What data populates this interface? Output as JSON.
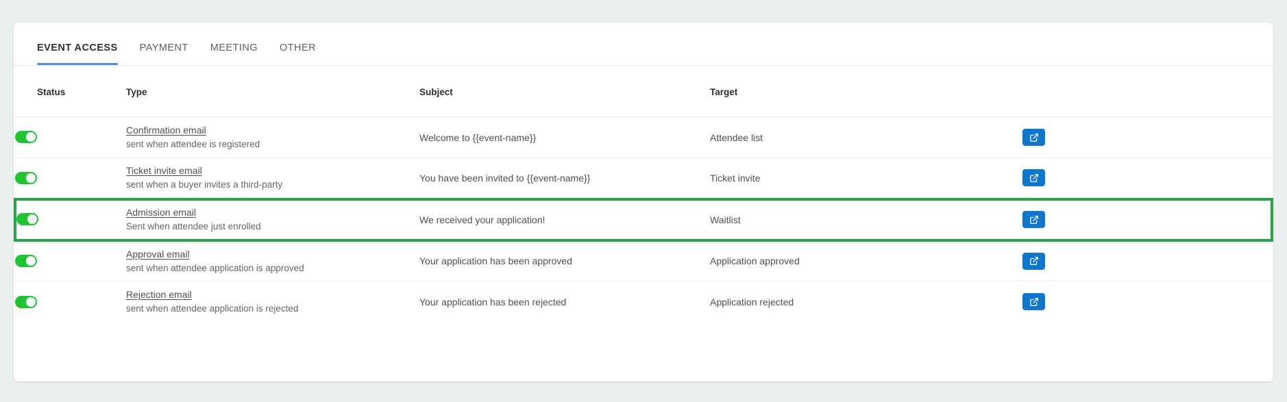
{
  "tabs": [
    {
      "label": "EVENT ACCESS",
      "active": true
    },
    {
      "label": "PAYMENT",
      "active": false
    },
    {
      "label": "MEETING",
      "active": false
    },
    {
      "label": "OTHER",
      "active": false
    }
  ],
  "table": {
    "headers": {
      "status": "Status",
      "type": "Type",
      "subject": "Subject",
      "target": "Target"
    },
    "rows": [
      {
        "enabled": true,
        "type_name": "Confirmation email",
        "type_desc": "sent when attendee is registered",
        "subject": "Welcome to {{event-name}}",
        "target": "Attendee list",
        "action_icon": "external-link-icon",
        "highlighted": false
      },
      {
        "enabled": true,
        "type_name": "Ticket invite email",
        "type_desc": "sent when a buyer invites a third-party",
        "subject": "You have been invited to {{event-name}}",
        "target": "Ticket invite",
        "action_icon": "external-link-icon",
        "highlighted": false
      },
      {
        "enabled": true,
        "type_name": "Admission email",
        "type_desc": "Sent when attendee just enrolled",
        "subject": "We received your application!",
        "target": "Waitlist",
        "action_icon": "external-link-icon",
        "highlighted": true
      },
      {
        "enabled": true,
        "type_name": "Approval email",
        "type_desc": "sent when attendee application is approved",
        "subject": "Your application has been approved",
        "target": "Application approved",
        "action_icon": "external-link-icon",
        "highlighted": false
      },
      {
        "enabled": true,
        "type_name": "Rejection email",
        "type_desc": "sent when attendee application is rejected",
        "subject": "Your application has been rejected",
        "target": "Application rejected",
        "action_icon": "external-link-icon",
        "highlighted": false
      }
    ]
  },
  "colors": {
    "accent_blue": "#4a90d9",
    "button_blue": "#1076cd",
    "toggle_green": "#1fc431",
    "highlight_green": "#21a845",
    "page_background": "#eceff0",
    "card_background": "#ffffff"
  }
}
